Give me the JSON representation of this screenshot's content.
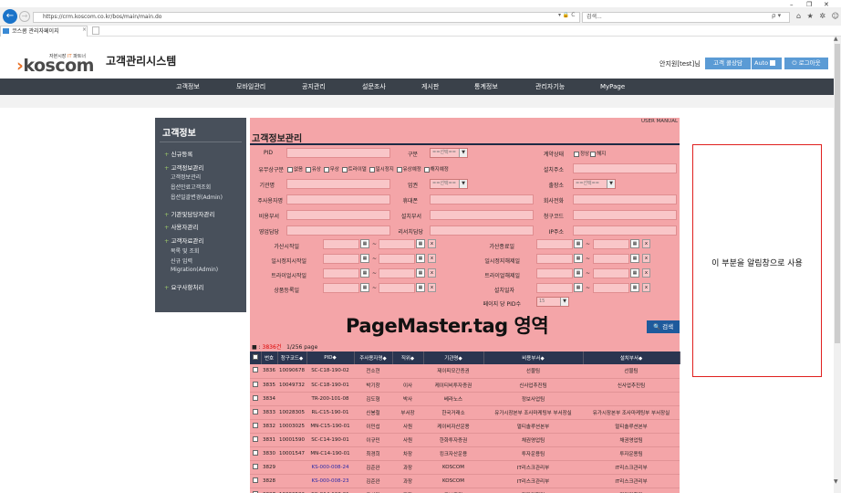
{
  "browser": {
    "url": "https://crm.koscom.co.kr/bos/main/main.do",
    "search_placeholder": "검색...",
    "tab_title": "코스콤 관리자페이지",
    "back": "←",
    "forward": "→",
    "url_icons": "▾ 🔒 C",
    "search_icon": "ρ ▾",
    "right_icons": "⌂ ★ ✲ ☺",
    "win_min": "–",
    "win_max": "❐",
    "win_close": "✕",
    "tab_close": "×",
    "scroll_up": "▲",
    "scroll_down": "▼"
  },
  "header": {
    "logo_sub_1": "자본시장",
    "logo_sub_it": "IT",
    "logo_sub_2": "파트너",
    "logo_mark": "›",
    "logo": "koscom",
    "app_title": "고객관리시스템",
    "user": "안지원[test]님",
    "consult_btn": "고객 콜상담",
    "auto_btn": "Auto",
    "logout_btn": "⏻ 로그아웃"
  },
  "nav": [
    "고객정보",
    "모바일관리",
    "공지관리",
    "설문조사",
    "게시판",
    "통계정보",
    "관리자기능",
    "MyPage"
  ],
  "sidebar": {
    "title": "고객정보",
    "items": [
      {
        "label": "신규등록"
      },
      {
        "label": "고객정보관리"
      },
      {
        "label": "기관및담당자관리"
      },
      {
        "label": "사용자관리"
      },
      {
        "label": "고객자료관리"
      },
      {
        "label": "요구사항처리"
      }
    ],
    "subs1": [
      "고객정보관리",
      "옵션만료고객조회",
      "옵션일괄변경(Admin)"
    ],
    "subs2": [
      "목록 및 조회",
      "신규 입력",
      "Migration(Admin)"
    ],
    "plus": "+"
  },
  "content": {
    "manual": "USER MANUAL",
    "title": "고객정보관리",
    "labels": {
      "pid": "PID",
      "gubun": "구분",
      "contract": "계약상태",
      "paid_type": "유무상구분",
      "install_addr": "설치주소",
      "org": "기관명",
      "industry": "업권",
      "branch": "출장소",
      "owner": "주사용자명",
      "mobile": "휴대폰",
      "company_phone": "회사전화",
      "dept": "비용부서",
      "install_dept": "설치부서",
      "billing_code": "청구코드",
      "sales": "영업담당",
      "risk": "리서치담당",
      "ip": "IP주소",
      "svc_start": "가산시작일",
      "svc_end": "가산종료일",
      "pause_start": "일시정지시작일",
      "pause_end": "일시정지해제일",
      "trial_start": "트라이얼시작일",
      "trial_end": "트라이얼해제일",
      "product_reg": "상품등록일",
      "install_date": "설치일자",
      "per_page": "페이지 당 PID수"
    },
    "select_placeholder": "==선택==",
    "per_page_value": "15",
    "contract_opts": [
      "정상",
      "해지"
    ],
    "paid_opts": [
      "없음",
      "유상",
      "무상",
      "트라이얼",
      "일시정지",
      "유상예정",
      "해지예정"
    ],
    "pagemaster": "PageMaster.tag 영역",
    "search_btn": "🔍 검색",
    "count": "3836",
    "count_suffix": "건",
    "page_info": "1/256 page",
    "count_dot": "■ :",
    "cal_icon": "▦",
    "clear": "x",
    "dash": "~",
    "arrow": "▼"
  },
  "table": {
    "headers": [
      "",
      "번호",
      "청구코드◆",
      "PID◆",
      "주사용자명◆",
      "직위◆",
      "기관명◆",
      "비용부서◆",
      "설치부서◆"
    ],
    "rows": [
      [
        "3836",
        "10090678",
        "SC-C18-190-02",
        "전소현",
        "",
        "제이피모간증권",
        "선물팀",
        "선물팀"
      ],
      [
        "3835",
        "10049732",
        "SC-C18-190-01",
        "박기창",
        "이사",
        "케이티비투자증권",
        "신사업추진팀",
        "신사업추진팀"
      ],
      [
        "3834",
        "",
        "TR-200-101-08",
        "김도형",
        "박사",
        "베라노스",
        "정보사업팀",
        ""
      ],
      [
        "3833",
        "10028305",
        "RL-C15-190-01",
        "신봉철",
        "부서장",
        "한국거래소",
        "유가시장본부 조사마케팅부 부서장실",
        "유가시장본부 조사마케팅부 부서장실"
      ],
      [
        "3832",
        "10003025",
        "MN-C15-190-01",
        "이민섭",
        "사원",
        "케이비자산운용",
        "멀티솔루션본부",
        "멀티솔루션본부"
      ],
      [
        "3831",
        "10001590",
        "SC-C14-190-01",
        "이규민",
        "사원",
        "한화투자증권",
        "채권영업팀",
        "채권영업팀"
      ],
      [
        "3830",
        "10001547",
        "MN-C14-190-01",
        "최경희",
        "차장",
        "킹크자산운용",
        "투자운용팀",
        "투자운용팀"
      ],
      [
        "3829",
        "",
        "KS-000-008-24",
        "김준완",
        "과장",
        "KOSCOM",
        "IT리스크관리부",
        "IT리스크관리부"
      ],
      [
        "3828",
        "",
        "KS-000-008-23",
        "김준완",
        "과장",
        "KOSCOM",
        "IT리스크관리부",
        "IT리스크관리부"
      ],
      [
        "3827",
        "10090522",
        "SC-C14-190-01",
        "유서리",
        "과장",
        "교보증권",
        "전략기획팀",
        "전략기획팀"
      ]
    ],
    "link_rows": [
      7,
      8
    ]
  },
  "notice": "이 부분을 알림창으로 사용"
}
